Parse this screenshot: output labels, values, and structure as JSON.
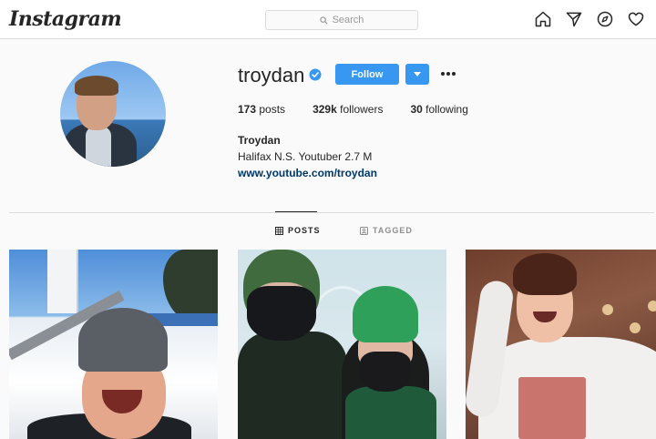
{
  "nav": {
    "logo_text": "Instagram",
    "search_placeholder": "Search",
    "icons": [
      "home-icon",
      "direct-icon",
      "explore-icon",
      "activity-heart-icon"
    ]
  },
  "profile": {
    "username": "troydan",
    "verified": true,
    "follow_label": "Follow",
    "stats": {
      "posts_count": "173",
      "posts_label": "posts",
      "followers_count": "329k",
      "followers_label": "followers",
      "following_count": "30",
      "following_label": "following"
    },
    "full_name": "Troydan",
    "bio": "Halifax N.S. Youtuber 2.7 M",
    "link": "www.youtube.com/troydan"
  },
  "tabs": [
    {
      "label": "POSTS",
      "active": true
    },
    {
      "label": "TAGGED",
      "active": false
    }
  ],
  "colors": {
    "accent": "#3897f0",
    "link": "#00376b",
    "text": "#262626",
    "muted": "#8e8e8e"
  }
}
